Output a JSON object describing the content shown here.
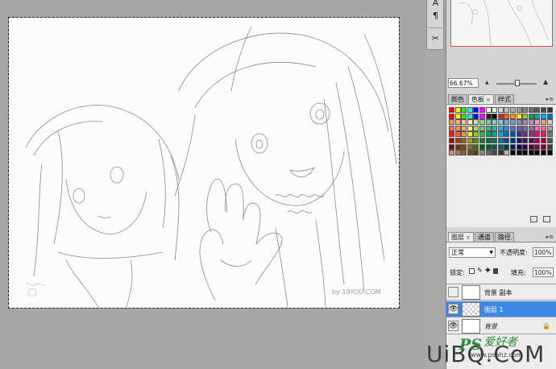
{
  "navigator": {
    "zoom": "66.67%"
  },
  "color_panel": {
    "tabs": [
      {
        "label": "颜色",
        "active": false
      },
      {
        "label": "色板",
        "active": true
      },
      {
        "label": "样式",
        "active": false
      }
    ],
    "close_glyph": "×",
    "swatch_colors": [
      [
        "#ff0000",
        "#ffff00",
        "#00ff00",
        "#00ffff",
        "#0000ff",
        "#ff00ff",
        "#ffffff",
        "#ebebeb",
        "#d6d6d6",
        "#c2c2c2",
        "#adadad",
        "#999999",
        "#858585",
        "#707070",
        "#5c5c5c",
        "#474747",
        "#333333"
      ],
      [
        "#ff0000",
        "#ffff00",
        "#00ff00",
        "#00ffff",
        "#0000ff",
        "#ff00ff",
        "#1f1f1f",
        "#000000",
        "#ed1c24",
        "#f26522",
        "#f7941d",
        "#fff200",
        "#8dc63f",
        "#00a651",
        "#00a99d",
        "#00aeef",
        "#0072bc"
      ],
      [
        "#f7977a",
        "#f9ad81",
        "#fdc68a",
        "#fff79a",
        "#c4df9b",
        "#a3d39c",
        "#82ca9d",
        "#7bcdc8",
        "#6ecff6",
        "#7ea7d8",
        "#8493ca",
        "#8882be",
        "#a187be",
        "#bc8dbf",
        "#f49ac2",
        "#f6989d",
        "#d2d2d2"
      ],
      [
        "#f26c4f",
        "#f68e55",
        "#fbaf5c",
        "#fff467",
        "#acd372",
        "#7cc576",
        "#3bb878",
        "#1abbb4",
        "#00bff3",
        "#438ccb",
        "#5574b9",
        "#605ca8",
        "#855fa8",
        "#a763a8",
        "#f06ea9",
        "#f26d7d",
        "#a4a4a4"
      ],
      [
        "#ed1c24",
        "#f26522",
        "#f7941d",
        "#fff200",
        "#8dc63f",
        "#39b54a",
        "#00a651",
        "#00a99d",
        "#00aeef",
        "#0072bc",
        "#0054a6",
        "#2e3192",
        "#662d91",
        "#92278f",
        "#ec008c",
        "#ed145b",
        "#767676"
      ],
      [
        "#9e0b0f",
        "#a0410d",
        "#a36209",
        "#aba000",
        "#598527",
        "#1a7b30",
        "#007236",
        "#00746b",
        "#0076a3",
        "#004b80",
        "#003471",
        "#1b1464",
        "#440e62",
        "#630460",
        "#9e005d",
        "#9e0039",
        "#555555"
      ],
      [
        "#790000",
        "#7b2e00",
        "#7d4900",
        "#827b00",
        "#406618",
        "#005e20",
        "#005826",
        "#005952",
        "#005b7f",
        "#003663",
        "#002157",
        "#0d004c",
        "#32004b",
        "#4b0049",
        "#7b0046",
        "#7a0026",
        "#3b3b3b"
      ],
      [
        "#c69c6d",
        "#a67c52",
        "#8c6239",
        "#754c24",
        "#603913",
        "#998675",
        "#736357",
        "#534741",
        "#37302d",
        "#c7b299",
        "#000000",
        "#000000",
        "#000000",
        "#000000",
        "#000000",
        "#000000",
        "#000000"
      ]
    ]
  },
  "layers_panel": {
    "tabs": [
      {
        "label": "图层",
        "active": true
      },
      {
        "label": "通道",
        "active": false
      },
      {
        "label": "路径",
        "active": false
      }
    ],
    "blend_mode": "正常",
    "opacity_label": "不透明度:",
    "opacity_value": "100%",
    "lock_label": "锁定:",
    "fill_label": "填充:",
    "fill_value": "100%",
    "layers": [
      {
        "name": "背景 副本",
        "visible": false,
        "selected": false,
        "locked": false
      },
      {
        "name": "图层 1",
        "visible": true,
        "selected": true,
        "locked": false
      },
      {
        "name": "背景",
        "visible": true,
        "selected": false,
        "locked": true
      }
    ]
  },
  "icons": {
    "tool1": "text-tool-icon",
    "tool2": "paragraph-icon",
    "tool3": "scissors-icon",
    "eye": "eye-icon",
    "lock": "lock-icon"
  },
  "watermark": {
    "canvas_text": "by 19YOU.COM",
    "logo_ps": "PS",
    "logo_cn": "爱好者",
    "url": "www.psahz.com",
    "big": "UiBQ.CoM"
  }
}
